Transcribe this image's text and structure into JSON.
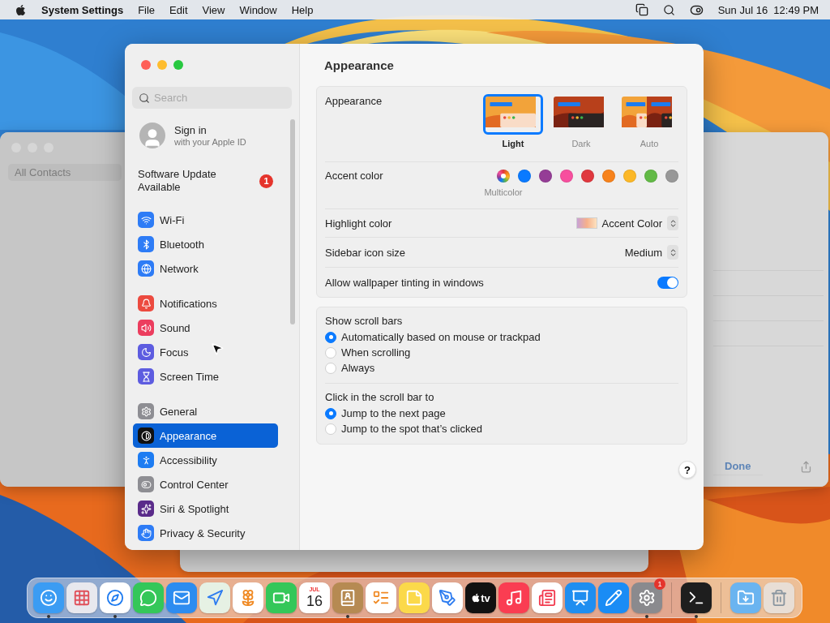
{
  "menu_bar": {
    "app_name": "System Settings",
    "menus": [
      "File",
      "Edit",
      "View",
      "Window",
      "Help"
    ],
    "clock": "Sun Jul 16  12:49 PM"
  },
  "background_window": {
    "sidebar_item": "All Contacts",
    "done_button": "Done"
  },
  "window": {
    "search": {
      "placeholder": "Search"
    },
    "account": {
      "title": "Sign in",
      "subtitle": "with your Apple ID"
    },
    "update": {
      "label": "Software Update Available",
      "badge": "1"
    },
    "sidebar_groups": [
      [
        {
          "label": "Wi-Fi",
          "kind": "wifi",
          "selected": false
        },
        {
          "label": "Bluetooth",
          "kind": "bluetooth",
          "selected": false
        },
        {
          "label": "Network",
          "kind": "network",
          "selected": false
        }
      ],
      [
        {
          "label": "Notifications",
          "kind": "notifications",
          "selected": false
        },
        {
          "label": "Sound",
          "kind": "sound",
          "selected": false
        },
        {
          "label": "Focus",
          "kind": "focus",
          "selected": false
        },
        {
          "label": "Screen Time",
          "kind": "screentime",
          "selected": false
        }
      ],
      [
        {
          "label": "General",
          "kind": "general",
          "selected": false
        },
        {
          "label": "Appearance",
          "kind": "appearance",
          "selected": true
        },
        {
          "label": "Accessibility",
          "kind": "accessibility",
          "selected": false
        },
        {
          "label": "Control Center",
          "kind": "controlcenter",
          "selected": false
        },
        {
          "label": "Siri & Spotlight",
          "kind": "siri",
          "selected": false
        },
        {
          "label": "Privacy & Security",
          "kind": "privacy",
          "selected": false
        }
      ]
    ],
    "title": "Appearance",
    "appearance": {
      "label": "Appearance",
      "options": [
        {
          "label": "Light",
          "kind": "light",
          "selected": true
        },
        {
          "label": "Dark",
          "kind": "dark",
          "selected": false
        },
        {
          "label": "Auto",
          "kind": "auto",
          "selected": false
        }
      ]
    },
    "accent": {
      "label": "Accent color",
      "caption": "Multicolor",
      "colors": [
        {
          "kind": "multicolor",
          "selected": true
        },
        {
          "kind": "solid",
          "color": "#0a7aff",
          "selected": false
        },
        {
          "kind": "solid",
          "color": "#953d96",
          "selected": false
        },
        {
          "kind": "solid",
          "color": "#f74f9e",
          "selected": false
        },
        {
          "kind": "solid",
          "color": "#e0383e",
          "selected": false
        },
        {
          "kind": "solid",
          "color": "#f7821b",
          "selected": false
        },
        {
          "kind": "solid",
          "color": "#fcb827",
          "selected": false
        },
        {
          "kind": "solid",
          "color": "#62ba46",
          "selected": false
        },
        {
          "kind": "solid",
          "color": "#989898",
          "selected": false
        }
      ]
    },
    "rows": [
      {
        "kind": "color_popup",
        "label": "Highlight color",
        "value": "Accent Color"
      },
      {
        "kind": "popup",
        "label": "Sidebar icon size",
        "value": "Medium"
      },
      {
        "kind": "toggle",
        "label": "Allow wallpaper tinting in windows",
        "on": true
      }
    ],
    "radio_groups": [
      {
        "title": "Show scroll bars",
        "options": [
          {
            "label": "Automatically based on mouse or trackpad",
            "selected": true
          },
          {
            "label": "When scrolling",
            "selected": false
          },
          {
            "label": "Always",
            "selected": false
          }
        ]
      },
      {
        "title": "Click in the scroll bar to",
        "options": [
          {
            "label": "Jump to the next page",
            "selected": true
          },
          {
            "label": "Jump to the spot that’s clicked",
            "selected": false
          }
        ]
      }
    ],
    "help_button": "?"
  },
  "dock": {
    "items": [
      {
        "kind": "finder",
        "running": true
      },
      {
        "kind": "launchpad",
        "running": false
      },
      {
        "kind": "safari",
        "running": true
      },
      {
        "kind": "messages",
        "running": false
      },
      {
        "kind": "mail",
        "running": false
      },
      {
        "kind": "maps",
        "running": false
      },
      {
        "kind": "photos",
        "running": false
      },
      {
        "kind": "facetime",
        "running": false
      },
      {
        "kind": "calendar",
        "running": false,
        "month": "JUL",
        "day": "16"
      },
      {
        "kind": "contacts",
        "running": true
      },
      {
        "kind": "reminders",
        "running": false
      },
      {
        "kind": "notes",
        "running": false
      },
      {
        "kind": "freeform",
        "running": false
      },
      {
        "kind": "tv",
        "running": false,
        "text": "tv"
      },
      {
        "kind": "music",
        "running": false
      },
      {
        "kind": "news",
        "running": false
      },
      {
        "kind": "keynote",
        "running": false
      },
      {
        "kind": "appstore",
        "running": false
      },
      {
        "kind": "settings",
        "running": true,
        "badge": "1"
      },
      {
        "kind": "separator"
      },
      {
        "kind": "terminal",
        "running": true
      },
      {
        "kind": "separator"
      },
      {
        "kind": "downloads",
        "running": false
      },
      {
        "kind": "trash",
        "running": false
      }
    ]
  }
}
